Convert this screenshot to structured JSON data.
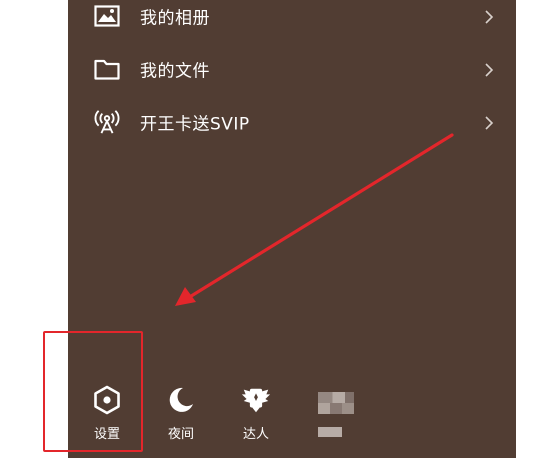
{
  "menu": {
    "items": [
      {
        "label": "我的相册",
        "icon": "photo-icon"
      },
      {
        "label": "我的文件",
        "icon": "folder-icon"
      },
      {
        "label": "开王卡送SVIP",
        "icon": "broadcast-tower-icon"
      }
    ]
  },
  "bottom_bar": {
    "items": [
      {
        "label": "设置",
        "icon": "settings-hexagon-icon"
      },
      {
        "label": "夜间",
        "icon": "moon-icon"
      },
      {
        "label": "达人",
        "icon": "winged-badge-icon"
      },
      {
        "label": "",
        "icon": "blurred-avatar"
      }
    ]
  },
  "annotation": {
    "color": "#e3262b",
    "type": "arrow-and-box",
    "target": "设置"
  },
  "colors": {
    "panel_background": "#513d33",
    "text": "#ffffff"
  }
}
